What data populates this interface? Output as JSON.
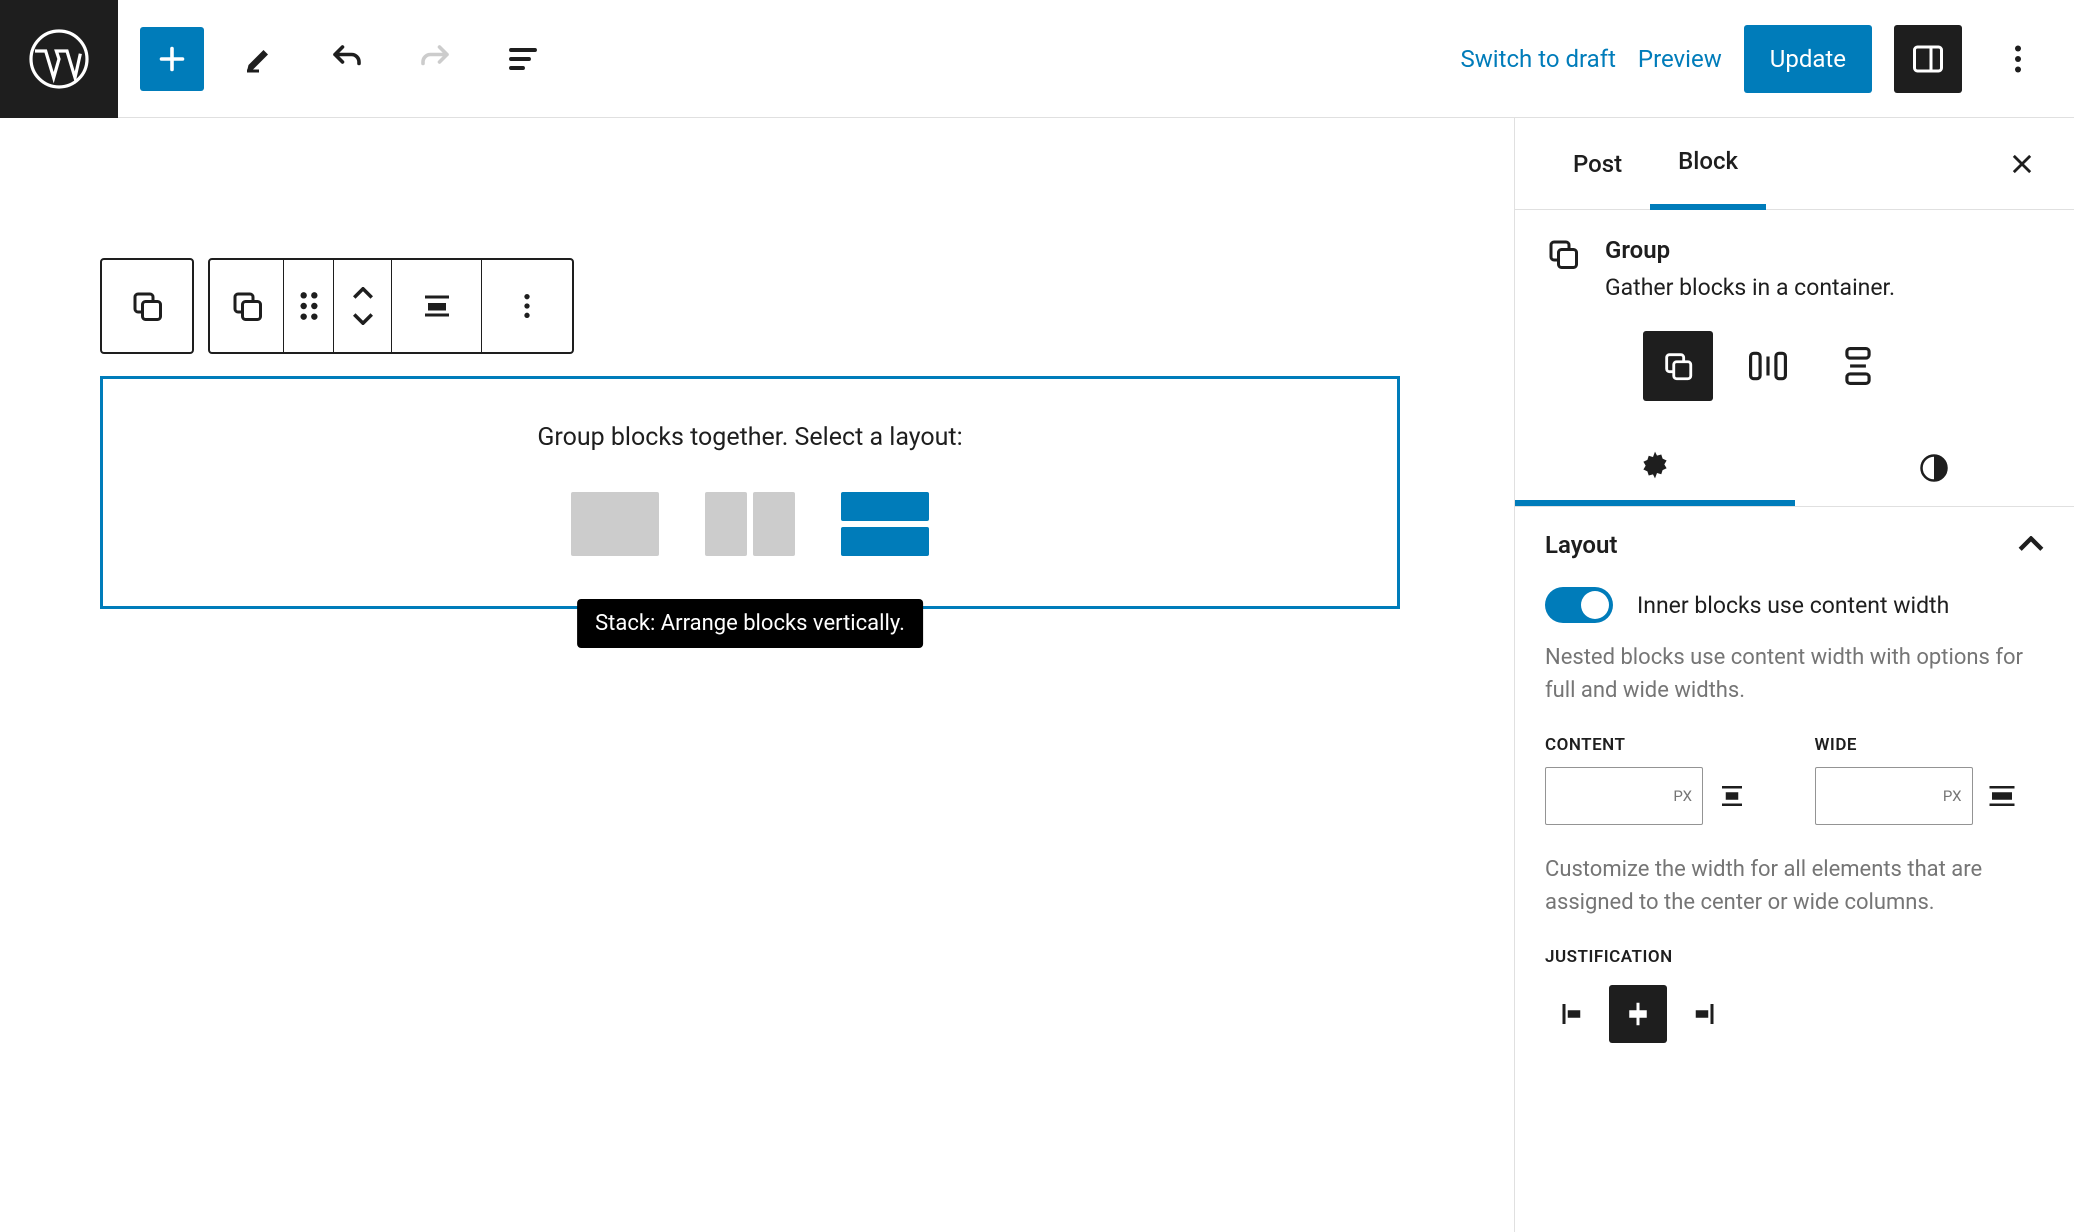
{
  "topbar": {
    "switch_draft": "Switch to draft",
    "preview": "Preview",
    "update": "Update"
  },
  "group_block": {
    "prompt": "Group blocks together. Select a layout:",
    "tooltip": "Stack: Arrange blocks vertically."
  },
  "sidebar": {
    "tabs": {
      "post": "Post",
      "block": "Block"
    },
    "block": {
      "title": "Group",
      "description": "Gather blocks in a container."
    },
    "layout": {
      "heading": "Layout",
      "toggle_label": "Inner blocks use content width",
      "toggle_help": "Nested blocks use content width with options for full and wide widths.",
      "content_label": "CONTENT",
      "wide_label": "WIDE",
      "unit": "PX",
      "width_help": "Customize the width for all elements that are assigned to the center or wide columns.",
      "justification_label": "JUSTIFICATION"
    }
  }
}
